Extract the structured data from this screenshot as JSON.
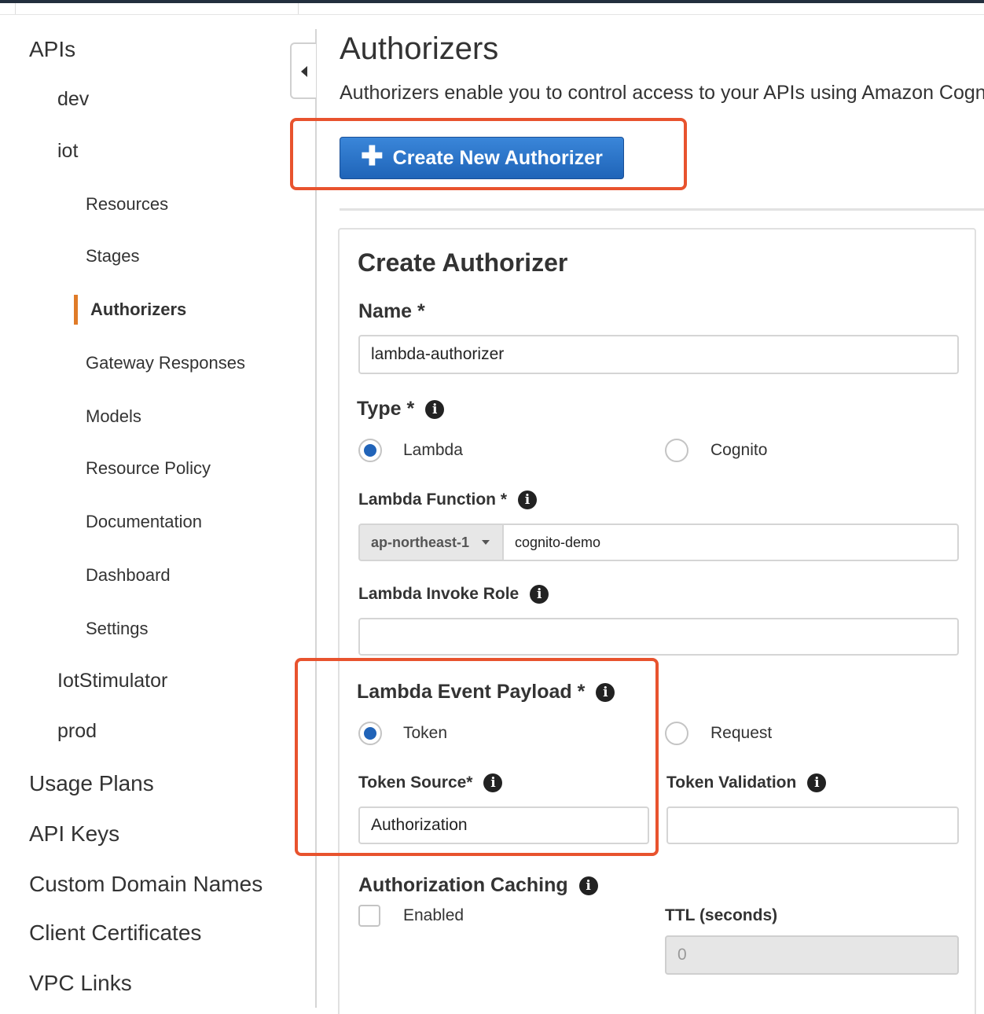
{
  "sidebar": {
    "apis": "APIs",
    "dev": "dev",
    "iot": "iot",
    "items": [
      "Resources",
      "Stages",
      "Authorizers",
      "Gateway Responses",
      "Models",
      "Resource Policy",
      "Documentation",
      "Dashboard",
      "Settings"
    ],
    "iot_stimulator": "IotStimulator",
    "prod": "prod",
    "usage_plans": "Usage Plans",
    "api_keys": "API Keys",
    "custom_domain_names": "Custom Domain Names",
    "client_certificates": "Client Certificates",
    "vpc_links": "VPC Links"
  },
  "header": {
    "title": "Authorizers",
    "description": "Authorizers enable you to control access to your APIs using Amazon Cognito"
  },
  "create_button": {
    "icon": "plus-icon",
    "label": "Create New Authorizer"
  },
  "form": {
    "title": "Create Authorizer",
    "name_label": "Name *",
    "name_value": "lambda-authorizer",
    "type_label": "Type *",
    "type_options": [
      "Lambda",
      "Cognito"
    ],
    "type_selected": "Lambda",
    "lambda_function_label": "Lambda Function *",
    "region": "ap-northeast-1",
    "function_value": "cognito-demo",
    "invoke_role_label": "Lambda Invoke Role",
    "invoke_role_value": "",
    "payload_label": "Lambda Event Payload *",
    "payload_options": [
      "Token",
      "Request"
    ],
    "payload_selected": "Token",
    "token_source_label": "Token Source*",
    "token_source_value": "Authorization",
    "token_validation_label": "Token Validation",
    "token_validation_value": "",
    "caching_label": "Authorization Caching",
    "caching_enabled_label": "Enabled",
    "caching_enabled": false,
    "ttl_label": "TTL (seconds)",
    "ttl_value": "0"
  },
  "colors": {
    "accent_button": "#1f64b8",
    "highlight": "#e8532e",
    "active_nav_bar": "#e07b28"
  }
}
